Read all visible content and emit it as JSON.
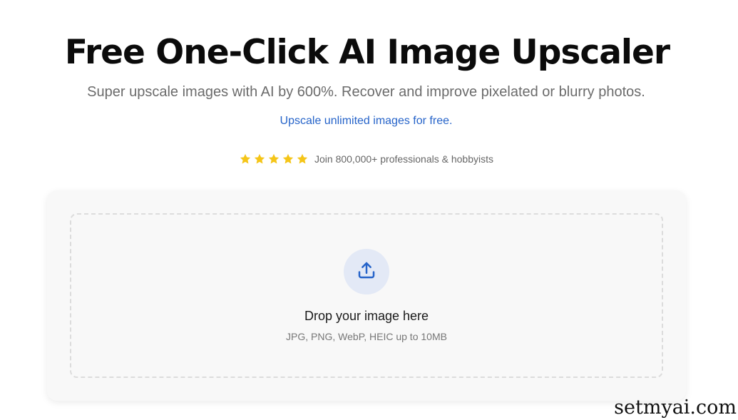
{
  "header": {
    "title": "Free One-Click AI Image Upscaler",
    "subtitle": "Super upscale images with AI by 600%. Recover and improve pixelated or blurry photos.",
    "promo_link": "Upscale unlimited images for free."
  },
  "rating": {
    "stars": 5,
    "star_color": "#f5c518",
    "text": "Join 800,000+ professionals & hobbyists"
  },
  "upload": {
    "icon": "upload-icon",
    "accent_color": "#2563c9",
    "title": "Drop your image here",
    "hint": "JPG, PNG, WebP, HEIC up to 10MB"
  },
  "watermark": {
    "text": "setmyai.com"
  }
}
